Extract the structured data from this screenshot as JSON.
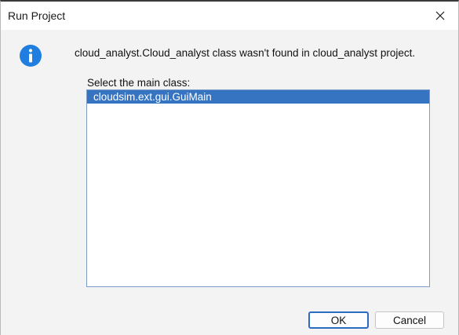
{
  "window": {
    "title": "Run Project",
    "close_icon": "close-icon"
  },
  "message": {
    "icon": "info-icon",
    "text": "cloud_analyst.Cloud_analyst class wasn't found in cloud_analyst project."
  },
  "class_list": {
    "label": "Select the main class:",
    "items": [
      {
        "label": "cloudsim.ext.gui.GuiMain",
        "selected": true
      }
    ]
  },
  "buttons": {
    "ok_label": "OK",
    "cancel_label": "Cancel"
  },
  "colors": {
    "selection": "#3674c2",
    "info_icon": "#1f7ee0",
    "default_button_border": "#2c6bc4"
  }
}
